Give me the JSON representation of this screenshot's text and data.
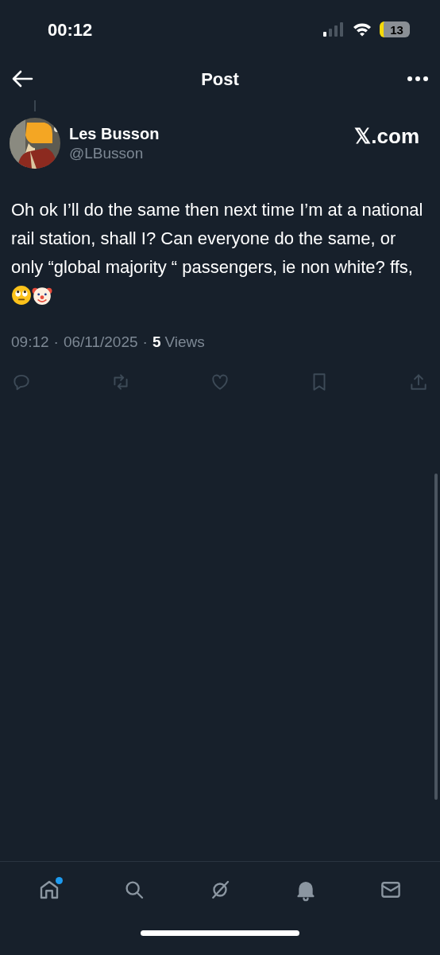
{
  "status_bar": {
    "time": "00:12",
    "battery": "13"
  },
  "header": {
    "title": "Post"
  },
  "post": {
    "author": {
      "name": "Les Busson",
      "handle": "@LBusson"
    },
    "source": "𝕏.com",
    "text": "Oh ok I’ll do the same then next time I’m at a national rail station, shall I? Can everyone do the same, or only “global majority “ passengers, ie non white? ffs,",
    "emojis": [
      {
        "kind": "eye-roll"
      },
      {
        "kind": "clown"
      }
    ],
    "time": "09:12",
    "separator_1": "·",
    "date": "06/11/2025",
    "separator_2": "·",
    "views_count": "5",
    "views_label": "Views",
    "actions": [
      {
        "kind": "reply"
      },
      {
        "kind": "repost"
      },
      {
        "kind": "like"
      },
      {
        "kind": "bookmark"
      },
      {
        "kind": "share"
      }
    ]
  },
  "bottom_nav": [
    {
      "kind": "home",
      "badge": true
    },
    {
      "kind": "search",
      "badge": false
    },
    {
      "kind": "grok",
      "badge": false
    },
    {
      "kind": "notifications",
      "badge": false
    },
    {
      "kind": "messages",
      "badge": false
    }
  ]
}
